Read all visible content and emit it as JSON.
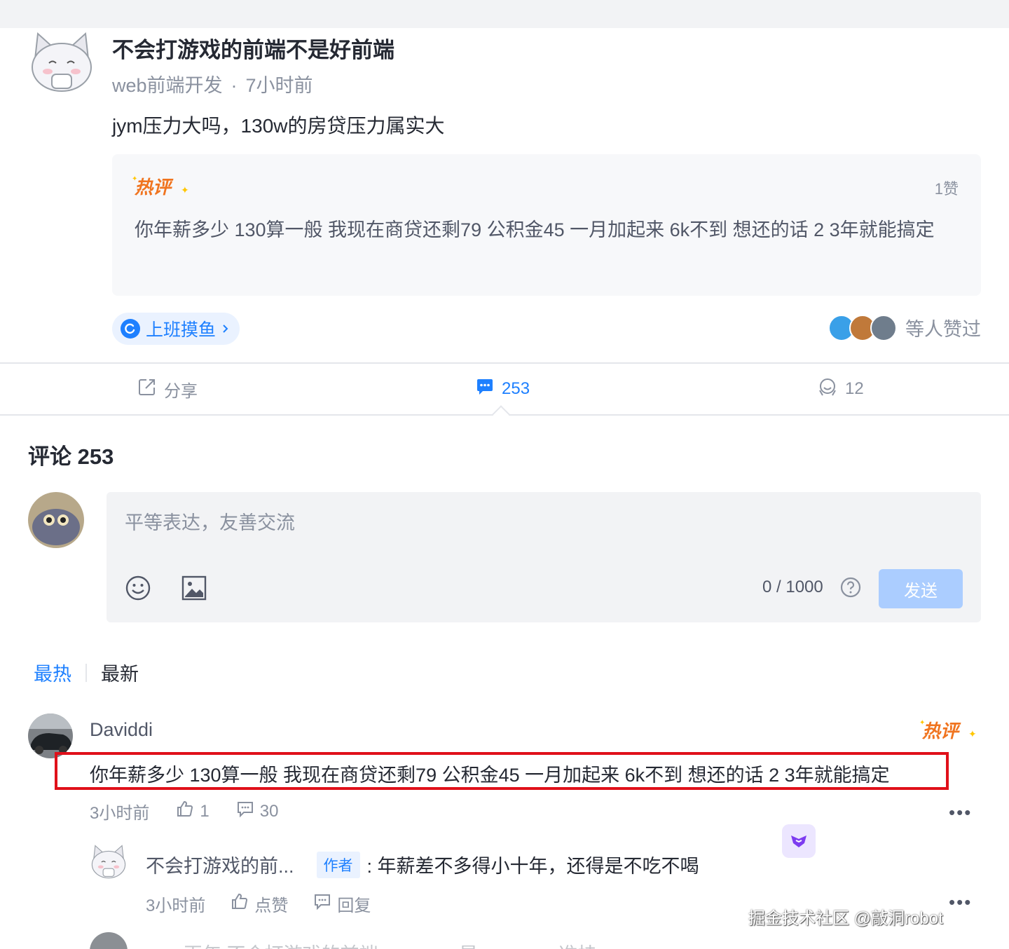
{
  "post": {
    "title": "不会打游戏的前端不是好前端",
    "circle": "web前端开发",
    "separator": "·",
    "time": "7小时前",
    "content": "jym压力大吗，130w的房贷压力属实大",
    "hot_comment": {
      "badge": "热评",
      "likes": "1赞",
      "text": "你年薪多少 130算一般 我现在商贷还剩79 公积金45 一月加起来 6k不到 想还的话 2 3年就能搞定"
    },
    "topic": "上班摸鱼",
    "likers_text": "等人赞过",
    "actions": {
      "share": "分享",
      "comments": "253",
      "likes": "12"
    }
  },
  "comments_section": {
    "title": "评论 253",
    "input_placeholder": "平等表达，友善交流",
    "char_count": "0 / 1000",
    "send_label": "发送",
    "sort": {
      "hot": "最热",
      "new": "最新"
    }
  },
  "comments": [
    {
      "name": "Daviddi",
      "badge": "热评",
      "text": "你年薪多少 130算一般 我现在商贷还剩79 公积金45 一月加起来 6k不到 想还的话 2 3年就能搞定",
      "time": "3小时前",
      "likes": "1",
      "replies": "30",
      "reply": {
        "name": "不会打游戏的前...",
        "author_badge": "作者",
        "text": ": 年薪差不多得小十年，还得是不吃不喝",
        "time": "3小时前",
        "like_label": "点赞",
        "reply_label": "回复"
      }
    }
  ],
  "next_comment_preview": "……再年 不会打游戏的前端……                        ……是……                  ……准挂",
  "watermark": "掘金技术社区 @敲洞robot",
  "colors": {
    "accent": "#1e80ff",
    "highlight_border": "#e0101a",
    "muted": "#8a919f"
  }
}
